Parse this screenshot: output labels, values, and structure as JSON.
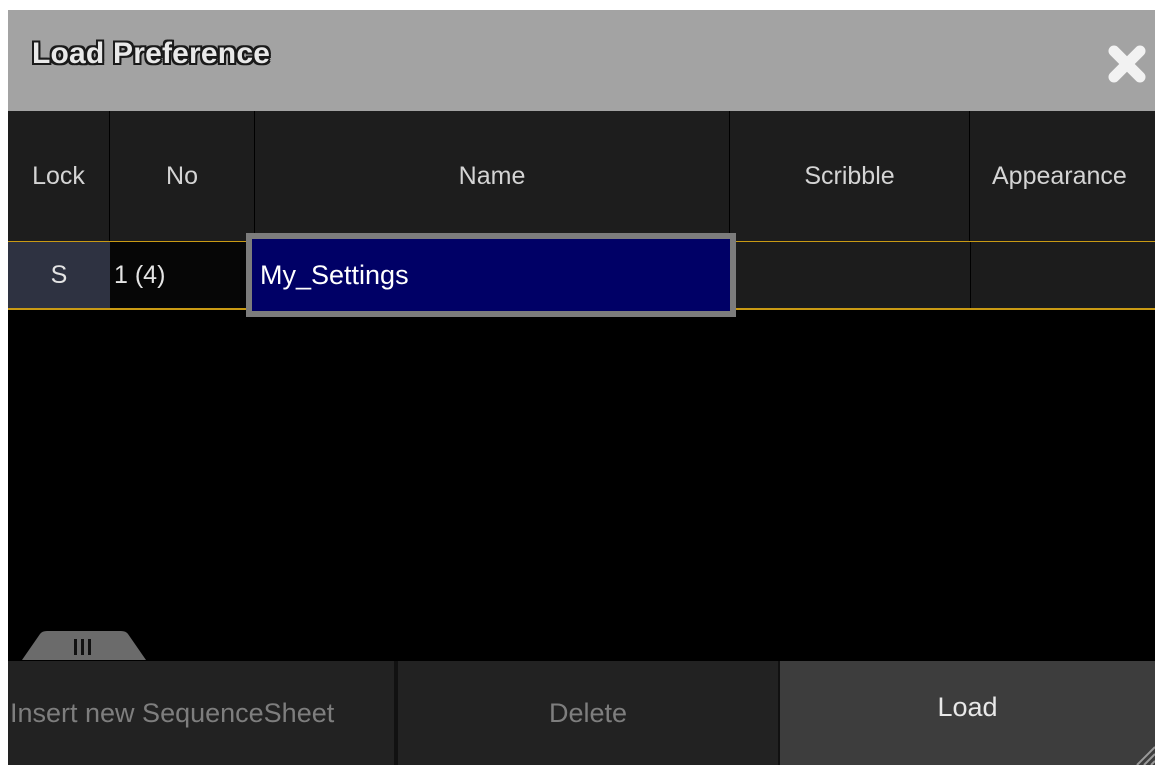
{
  "window": {
    "title": "Load Preference",
    "close_icon": "close-x-icon"
  },
  "table": {
    "columns": [
      "Lock",
      "No",
      "Name",
      "Scribble",
      "Appearance"
    ],
    "rows": [
      {
        "lock": "S",
        "no": "1 (4)",
        "name": "My_Settings",
        "scribble": "",
        "appearance": ""
      }
    ]
  },
  "scroll_handle": {
    "icon": "grip-lines-icon",
    "label": "III"
  },
  "buttons": {
    "insert_label": "Insert new SequenceSheet",
    "delete_label": "Delete",
    "load_label": "Load"
  },
  "colors": {
    "title_bar": "#a3a3a3",
    "row_separator": "#c99a14",
    "edit_background": "#000066",
    "lock_cell": "#2e3241"
  }
}
